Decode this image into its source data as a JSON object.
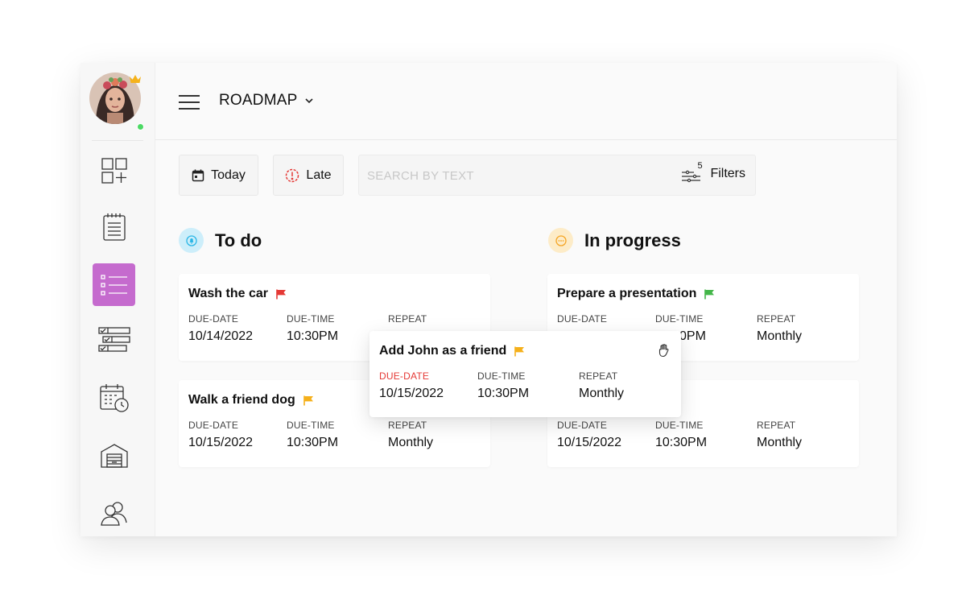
{
  "header": {
    "board_title": "ROADMAP"
  },
  "toolbar": {
    "today_label": "Today",
    "late_label": "Late",
    "search_placeholder": "SEARCH BY TEXT",
    "filters_label": "Filters",
    "filters_count": "5"
  },
  "columns": [
    {
      "title": "To do",
      "color": "#cdeefa",
      "cards": [
        {
          "title": "Wash the car",
          "flag_color": "#e53935",
          "due_date": "10/14/2022",
          "due_time": "10:30PM",
          "repeat": ""
        },
        {
          "title": "Walk a friend dog",
          "flag_color": "#f5b01b",
          "due_date": "10/15/2022",
          "due_time": "10:30PM",
          "repeat": "Monthly"
        }
      ]
    },
    {
      "title": "In progress",
      "color": "#fdecc8",
      "cards": [
        {
          "title": "Prepare a presentation",
          "flag_color": "#43b649",
          "due_date": "",
          "due_time": "0PM",
          "repeat": "Monthly"
        },
        {
          "title": "",
          "flag_color": "",
          "due_date": "10/15/2022",
          "due_time": "10:30PM",
          "repeat": "Monthly"
        }
      ]
    }
  ],
  "dragged_card": {
    "title": "Add John as a friend",
    "flag_color": "#f5b01b",
    "due_date": "10/15/2022",
    "due_time": "10:30PM",
    "repeat": "Monthly"
  },
  "labels": {
    "due_date": "DUE-DATE",
    "due_time": "DUE-TIME",
    "repeat": "REPEAT"
  },
  "colors": {
    "active_nav": "#c56bce",
    "late_icon": "#e53935"
  }
}
